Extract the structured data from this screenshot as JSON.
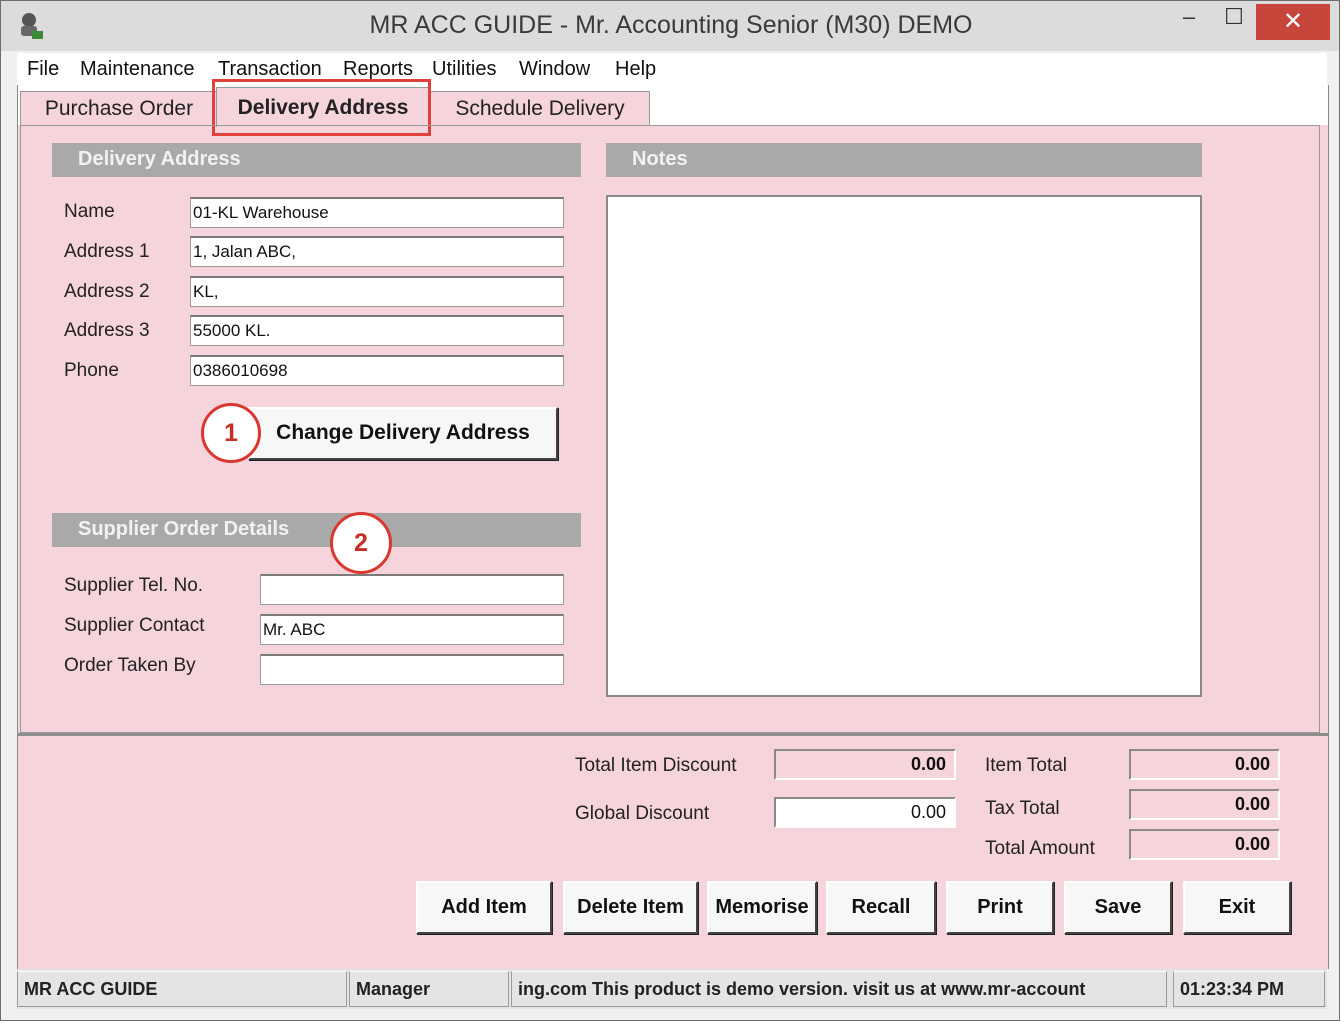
{
  "window": {
    "title": "MR ACC GUIDE - Mr. Accounting Senior (M30) DEMO",
    "min_glyph": "–",
    "max_glyph": "☐",
    "close_glyph": "✕"
  },
  "menu": [
    "File",
    "Maintenance",
    "Transaction",
    "Reports",
    "Utilities",
    "Window",
    "Help"
  ],
  "tabs": [
    "Purchase Order",
    "Delivery Address",
    "Schedule Delivery"
  ],
  "delivery": {
    "section_title": "Delivery Address",
    "labels": [
      "Name",
      "Address 1",
      "Address 2",
      "Address 3",
      "Phone"
    ],
    "values": [
      "01-KL Warehouse",
      "1, Jalan ABC,",
      "KL,",
      "55000 KL.",
      "0386010698"
    ],
    "change_button": "Change Delivery Address"
  },
  "notes": {
    "title": "Notes",
    "value": ""
  },
  "supplier": {
    "section_title": "Supplier Order Details",
    "labels": [
      "Supplier Tel. No.",
      "Supplier Contact",
      "Order Taken By"
    ],
    "values": [
      "",
      "Mr. ABC",
      ""
    ]
  },
  "callouts": [
    "1",
    "2"
  ],
  "totals": {
    "total_item_discount_label": "Total Item Discount",
    "total_item_discount": "0.00",
    "global_discount_label": "Global Discount",
    "global_discount": "0.00",
    "item_total_label": "Item Total",
    "item_total": "0.00",
    "tax_total_label": "Tax Total",
    "tax_total": "0.00",
    "total_amount_label": "Total Amount",
    "total_amount": "0.00"
  },
  "buttons": [
    "Add Item",
    "Delete Item",
    "Memorise",
    "Recall",
    "Print",
    "Save",
    "Exit"
  ],
  "status": {
    "app": "MR ACC GUIDE",
    "user": "Manager",
    "message": "ing.com This product is demo version.  visit us at www.mr-account",
    "time": "01:23:34 PM"
  },
  "colors": {
    "panel_bg": "#f6d4dc",
    "section_bar": "#a9a9a9",
    "highlight": "#e0413a",
    "close_button": "#c7453a"
  }
}
